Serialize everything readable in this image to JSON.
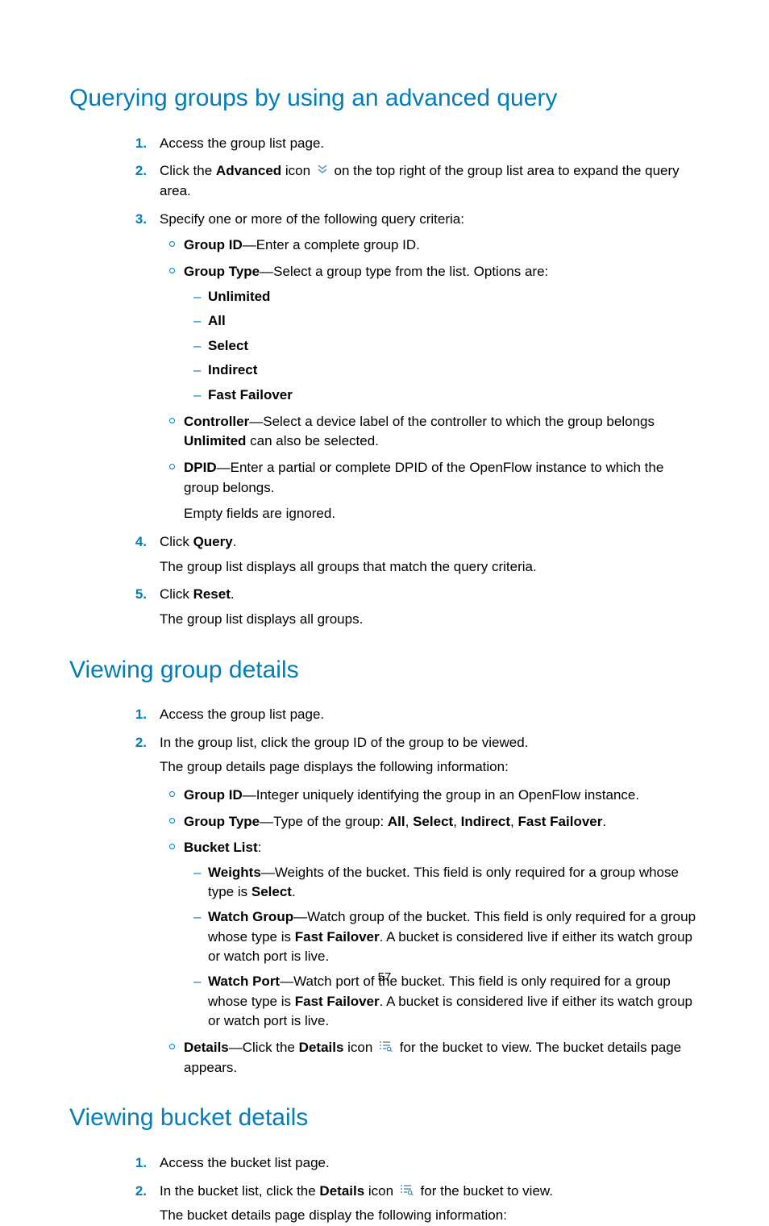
{
  "page_number": "57",
  "sections": [
    {
      "heading": "Querying groups by using an advanced query",
      "steps": [
        {
          "num": "1.",
          "text_pre": "Access the group list page."
        },
        {
          "num": "2.",
          "text_pre": "Click the ",
          "bold1": "Advanced",
          "text_mid": " icon ",
          "icon": "advanced",
          "text_post": " on the top right of the group list area to expand the query area."
        },
        {
          "num": "3.",
          "text_pre": "Specify one or more of the following query criteria:",
          "criteria": [
            {
              "label": "Group ID",
              "tail": "—Enter a complete group ID."
            },
            {
              "label": "Group Type",
              "tail": "—Select a group type from the list. Options are:",
              "options": [
                "Unlimited",
                "All",
                "Select",
                "Indirect",
                "Fast Failover"
              ]
            },
            {
              "label": "Controller",
              "tail_pre": "—Select a device label of the controller to which the group belongs ",
              "bold_in": "Unlimited",
              "tail_post": " can also be selected."
            },
            {
              "label": "DPID",
              "tail": "—Enter a partial or complete DPID of the OpenFlow instance to which the group belongs."
            }
          ],
          "after_criteria": "Empty fields are ignored."
        },
        {
          "num": "4.",
          "text_pre": "Click ",
          "bold1": "Query",
          "text_post": ".",
          "after": "The group list displays all groups that match the query criteria."
        },
        {
          "num": "5.",
          "text_pre": "Click ",
          "bold1": "Reset",
          "text_post": ".",
          "after": "The group list displays all groups."
        }
      ]
    },
    {
      "heading": "Viewing group details",
      "steps": [
        {
          "num": "1.",
          "text_pre": "Access the group list page."
        },
        {
          "num": "2.",
          "text_pre": "In the group list, click the group ID of the group to be viewed.",
          "after": "The group details page displays the following information:",
          "criteria": [
            {
              "label": "Group ID",
              "tail": "—Integer uniquely identifying the group in an OpenFlow instance."
            },
            {
              "label": "Group Type",
              "tail_pre": "—Type of the group: ",
              "seq": [
                "All",
                "Select",
                "Indirect",
                "Fast Failover"
              ]
            },
            {
              "label": "Bucket List",
              "tail": ":",
              "bucket": [
                {
                  "label": "Weights",
                  "tail_pre": "—Weights of the bucket. This field is only required for a group whose type is ",
                  "bold_in": "Select",
                  "tail_post": "."
                },
                {
                  "label": "Watch Group",
                  "tail_pre": "—Watch group of the bucket. This field is only required for a group whose type is ",
                  "bold_in": "Fast Failover",
                  "tail_post": ". A bucket is considered live if either its watch group or watch port is live."
                },
                {
                  "label": "Watch Port",
                  "tail_pre": "—Watch port of the bucket. This field is only required for a group whose type is ",
                  "bold_in": "Fast Failover",
                  "tail_post": ". A bucket is considered live if either its watch group or watch port is live."
                }
              ]
            },
            {
              "label": "Details",
              "tail_pre": "—Click the ",
              "bold_in": "Details",
              "tail_mid": " icon ",
              "icon": "details",
              "tail_post": " for the bucket to view. The bucket details page appears."
            }
          ]
        }
      ]
    },
    {
      "heading": "Viewing bucket details",
      "steps": [
        {
          "num": "1.",
          "text_pre": "Access the bucket list page."
        },
        {
          "num": "2.",
          "text_pre": "In the bucket list, click the ",
          "bold1": "Details",
          "text_mid": " icon ",
          "icon": "details",
          "text_post": " for the bucket to view.",
          "after": "The bucket details page display the following information:"
        }
      ]
    }
  ]
}
